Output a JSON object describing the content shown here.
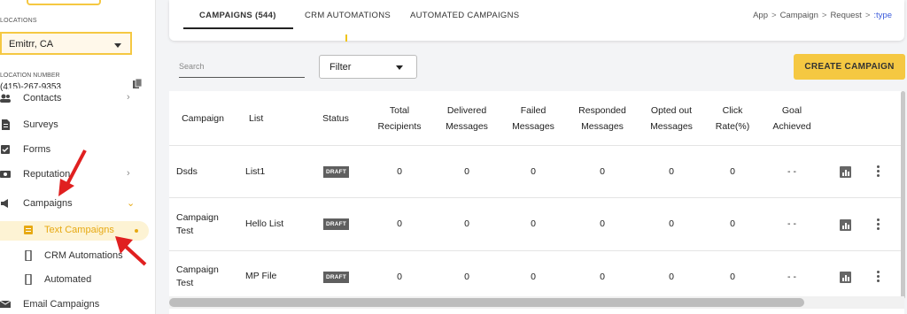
{
  "sidebar": {
    "location_label": "LOCATIONS",
    "location_value": "Emitrr, CA",
    "location_number_label": "LOCATION NUMBER",
    "location_number": "(415)-267-9353",
    "items": [
      {
        "label": "Contacts",
        "icon": "contacts-icon"
      },
      {
        "label": "Surveys",
        "icon": "survey-icon"
      },
      {
        "label": "Forms",
        "icon": "forms-icon"
      },
      {
        "label": "Reputation",
        "icon": "reputation-icon"
      },
      {
        "label": "Campaigns",
        "icon": "megaphone-icon"
      },
      {
        "label": "Text Campaigns",
        "icon": "text-campaign-icon"
      },
      {
        "label": "CRM Automations",
        "icon": "phone-icon"
      },
      {
        "label": "Automated",
        "icon": "phone-icon"
      },
      {
        "label": "Email Campaigns",
        "icon": "email-icon"
      }
    ],
    "accent_color": "#e7a912"
  },
  "tabs": [
    {
      "label": "CAMPAIGNS (544)",
      "active": true
    },
    {
      "label": "CRM AUTOMATIONS",
      "active": false
    },
    {
      "label": "AUTOMATED CAMPAIGNS",
      "active": false
    }
  ],
  "breadcrumb": [
    "App",
    "Campaign",
    "Request",
    ":type"
  ],
  "toolbar": {
    "search_placeholder": "Search",
    "filter_label": "Filter",
    "create_label": "CREATE CAMPAIGN",
    "create_color": "#f5c842"
  },
  "table": {
    "headers": [
      "Campaign",
      "List",
      "Status",
      "Total\nRecipients",
      "Delivered\nMessages",
      "Failed\nMessages",
      "Responded\nMessages",
      "Opted out\nMessages",
      "Click\nRate(%)",
      "Goal\nAchieved"
    ],
    "rows": [
      {
        "campaign": "Dsds",
        "list": "List1",
        "status": "DRAFT",
        "total": "0",
        "delivered": "0",
        "failed": "0",
        "responded": "0",
        "opted_out": "0",
        "click_rate": "0",
        "goal": "- -"
      },
      {
        "campaign": "Campaign\nTest",
        "list": "Hello List",
        "status": "DRAFT",
        "total": "0",
        "delivered": "0",
        "failed": "0",
        "responded": "0",
        "opted_out": "0",
        "click_rate": "0",
        "goal": "- -"
      },
      {
        "campaign": "Campaign\nTest",
        "list": "MP File",
        "status": "DRAFT",
        "total": "0",
        "delivered": "0",
        "failed": "0",
        "responded": "0",
        "opted_out": "0",
        "click_rate": "0",
        "goal": "- -"
      }
    ]
  }
}
